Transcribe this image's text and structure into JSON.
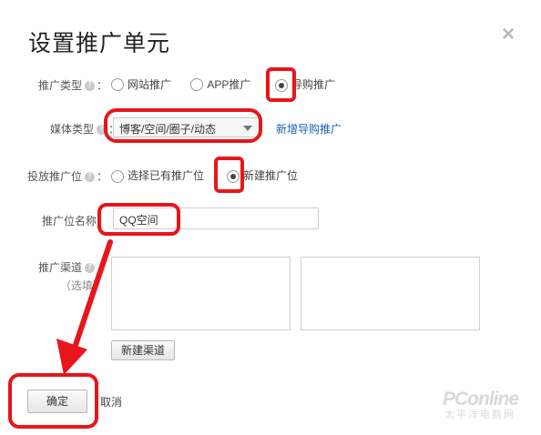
{
  "dialog": {
    "title": "设置推广单元",
    "close_label": "×"
  },
  "form": {
    "promo_type": {
      "label": "推广类型",
      "help": "?",
      "colon": "：",
      "options": [
        "网站推广",
        "APP推广",
        "导购推广"
      ],
      "selected": "导购推广"
    },
    "media_type": {
      "label": "媒体类型",
      "help": "?",
      "colon": "：",
      "value": "博客/空间/圈子/动态",
      "add_link": "新增导购推广"
    },
    "ad_position": {
      "label": "投放推广位",
      "help": "?",
      "colon": "：",
      "options": [
        "选择已有推广位",
        "新建推广位"
      ],
      "selected": "新建推广位"
    },
    "position_name": {
      "label": "推广位名称",
      "value": "QQ空间"
    },
    "channel": {
      "label": "推广渠道",
      "help": "?",
      "optional": "（选填）",
      "new_channel_button": "新建渠道"
    }
  },
  "actions": {
    "confirm": "确定",
    "cancel": "取消"
  },
  "watermark": {
    "brand": "PConline",
    "sub": "太平洋电脑网"
  },
  "colors": {
    "highlight": "#e8151b",
    "link": "#1a5fb4"
  }
}
